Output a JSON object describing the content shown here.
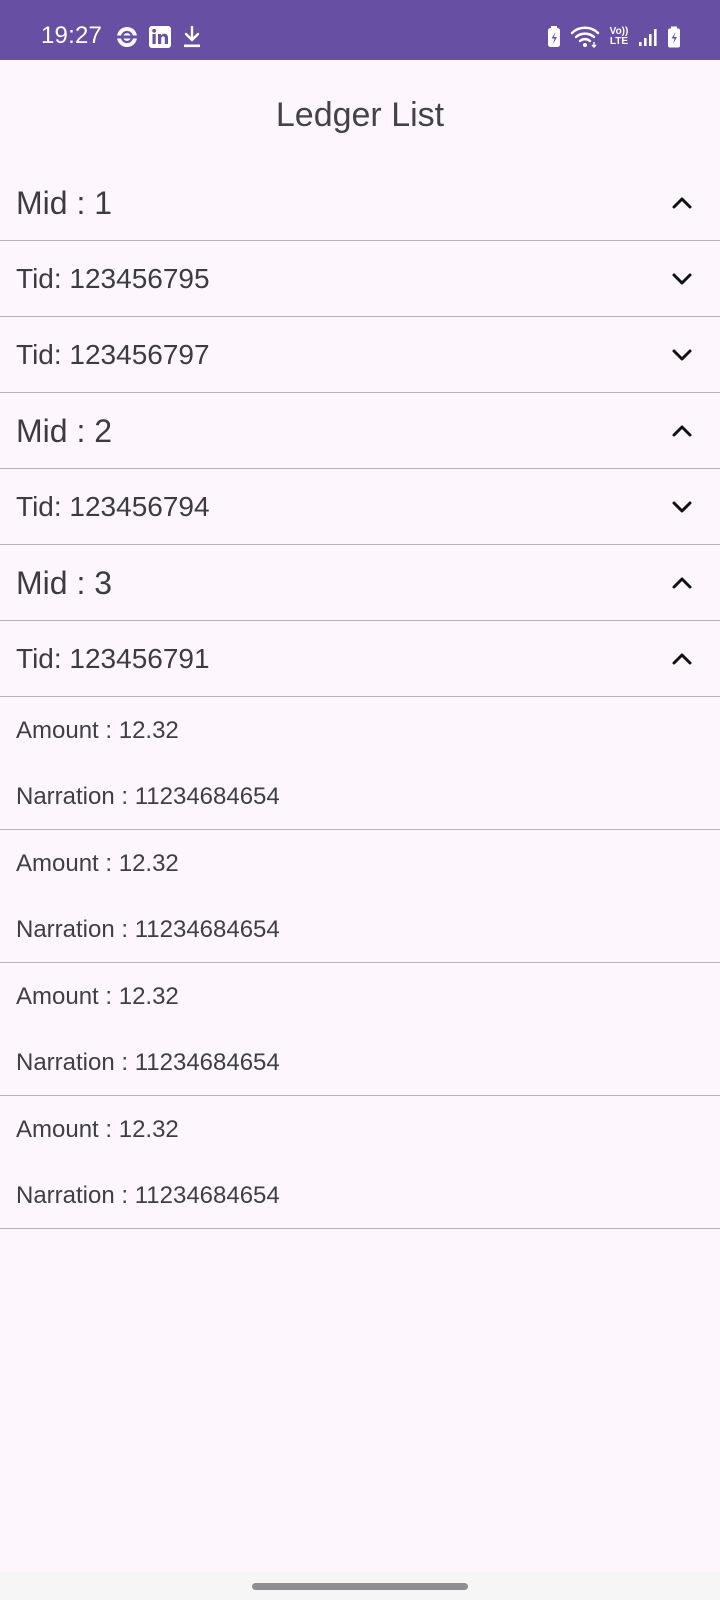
{
  "status_bar": {
    "time": "19:27",
    "left_icons": [
      "sync-icon",
      "linkedin-icon",
      "download-icon"
    ],
    "right_icons": [
      "battery-saver-icon",
      "wifi-icon",
      "volte-icon",
      "signal-icon",
      "battery-charging-icon"
    ],
    "volte_top": "Vo))",
    "volte_bottom": "LTE",
    "background": "#6750a4"
  },
  "title": "Ledger List",
  "groups": [
    {
      "label": "Mid : 1",
      "expanded": true,
      "tids": [
        {
          "label": "Tid: 123456795",
          "expanded": false
        },
        {
          "label": "Tid: 123456797",
          "expanded": false
        }
      ]
    },
    {
      "label": "Mid : 2",
      "expanded": true,
      "tids": [
        {
          "label": "Tid: 123456794",
          "expanded": false
        }
      ]
    },
    {
      "label": "Mid : 3",
      "expanded": true,
      "tids": [
        {
          "label": "Tid: 123456791",
          "expanded": true,
          "entries": [
            {
              "amount": "Amount : 12.32",
              "narration": "Narration : 11234684654"
            },
            {
              "amount": "Amount : 12.32",
              "narration": "Narration : 11234684654"
            },
            {
              "amount": "Amount : 12.32",
              "narration": "Narration : 11234684654"
            },
            {
              "amount": "Amount : 12.32",
              "narration": "Narration : 11234684654"
            }
          ]
        }
      ]
    }
  ]
}
